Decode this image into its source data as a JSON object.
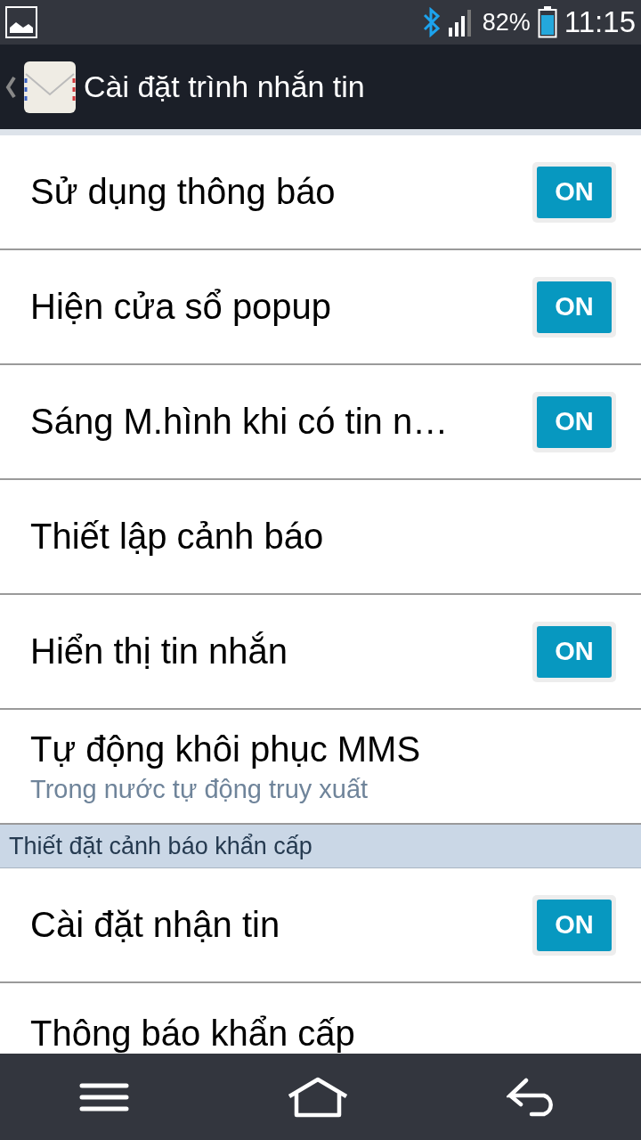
{
  "status_bar": {
    "battery": "82%",
    "time": "11:15"
  },
  "title_bar": {
    "title": "Cài đặt trình nhắn tin"
  },
  "sections": [
    {
      "items": [
        {
          "kind": "toggle",
          "label": "Sử dụng thông báo",
          "on": true,
          "switch_text": "ON"
        },
        {
          "kind": "toggle",
          "label": "Hiện cửa sổ popup",
          "on": true,
          "switch_text": "ON"
        },
        {
          "kind": "toggle",
          "label": "Sáng M.hình khi có tin n…",
          "on": true,
          "switch_text": "ON"
        },
        {
          "kind": "plain",
          "label": "Thiết lập cảnh báo"
        },
        {
          "kind": "toggle",
          "label": "Hiển thị tin nhắn",
          "on": true,
          "switch_text": "ON"
        },
        {
          "kind": "subtitle",
          "label": "Tự động khôi phục MMS",
          "summary": "Trong nước tự động truy xuất"
        }
      ]
    },
    {
      "header": "Thiết đặt cảnh báo khẩn cấp",
      "items": [
        {
          "kind": "toggle",
          "label": "Cài đặt nhận tin",
          "on": true,
          "switch_text": "ON"
        },
        {
          "kind": "plain",
          "label": "Thông báo khẩn cấp"
        }
      ]
    }
  ]
}
